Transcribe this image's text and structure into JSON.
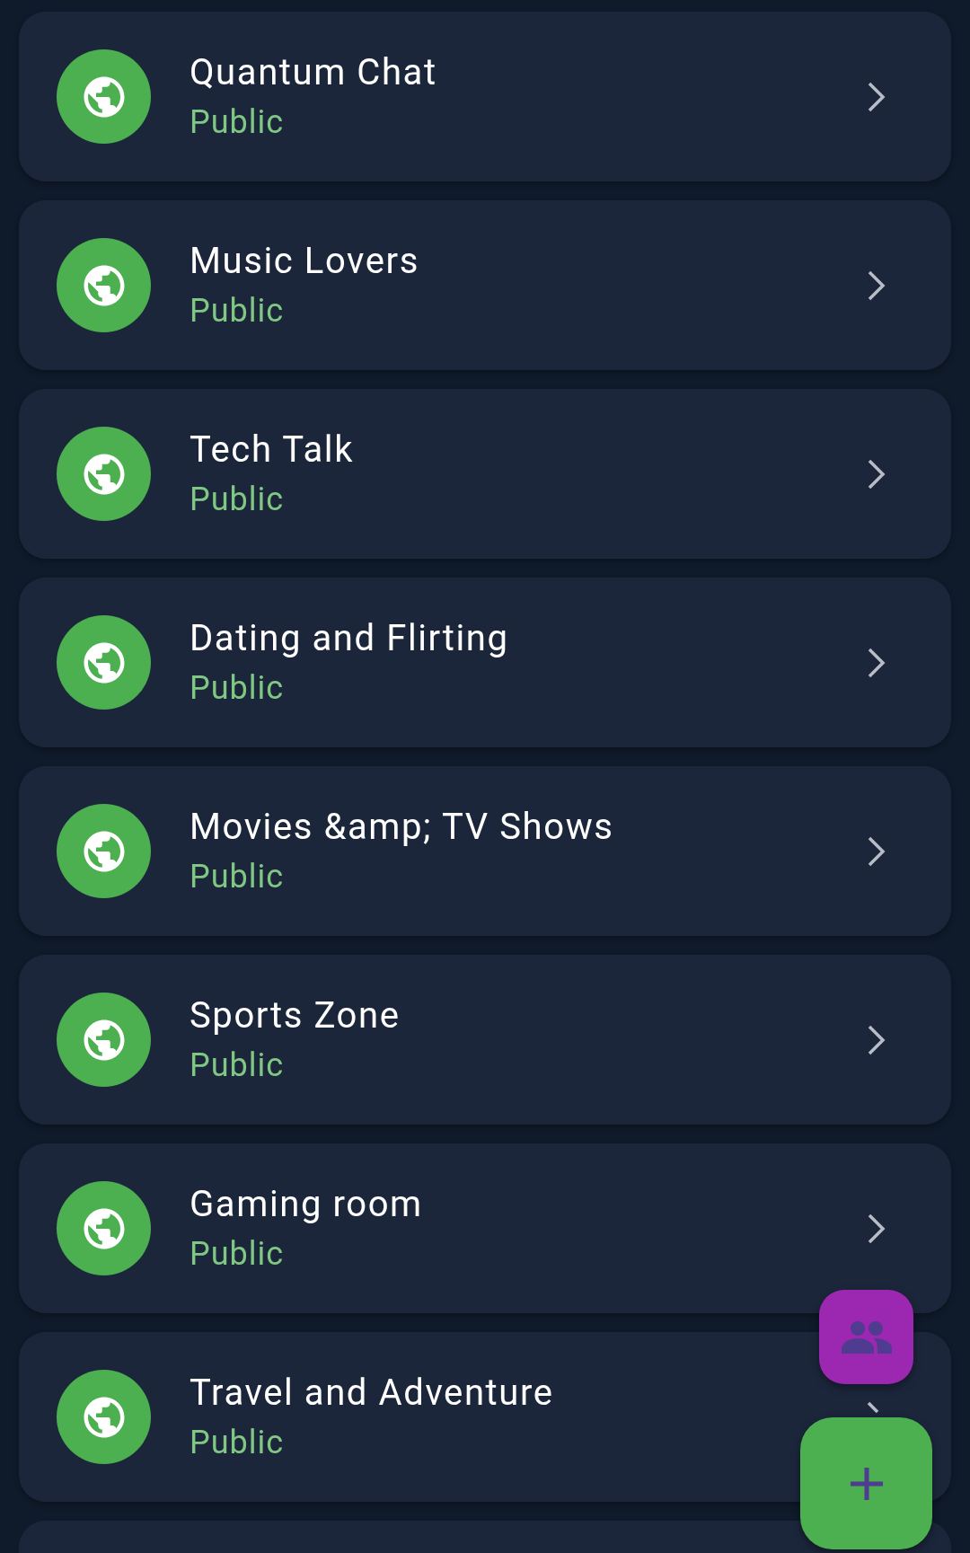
{
  "rooms": [
    {
      "name": "Quantum Chat",
      "visibility": "Public"
    },
    {
      "name": "Music Lovers",
      "visibility": "Public"
    },
    {
      "name": "Tech Talk",
      "visibility": "Public"
    },
    {
      "name": "Dating and Flirting",
      "visibility": "Public"
    },
    {
      "name": "Movies &amp; TV Shows",
      "visibility": "Public"
    },
    {
      "name": "Sports Zone",
      "visibility": "Public"
    },
    {
      "name": "Gaming room",
      "visibility": "Public"
    },
    {
      "name": "Travel and Adventure",
      "visibility": "Public"
    }
  ]
}
